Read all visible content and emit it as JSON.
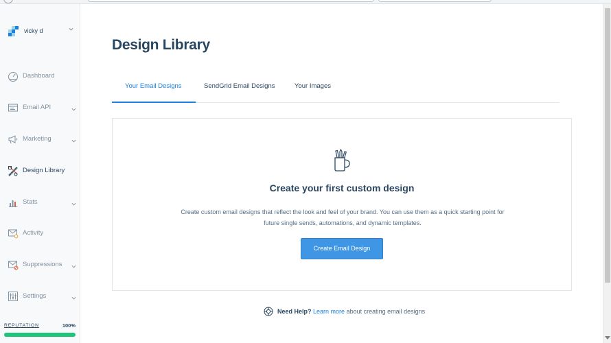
{
  "account": {
    "name": "vicky d"
  },
  "sidebar": {
    "items": [
      {
        "label": "Dashboard",
        "icon": "dashboard-gauge-icon",
        "has_caret": false
      },
      {
        "label": "Email API",
        "icon": "email-api-window-icon",
        "has_caret": true
      },
      {
        "label": "Marketing",
        "icon": "megaphone-icon",
        "has_caret": true
      },
      {
        "label": "Design Library",
        "icon": "design-tools-icon",
        "has_caret": false,
        "active": true
      },
      {
        "label": "Stats",
        "icon": "bar-chart-icon",
        "has_caret": true
      },
      {
        "label": "Activity",
        "icon": "activity-envelope-icon",
        "has_caret": false
      },
      {
        "label": "Suppressions",
        "icon": "suppression-envelope-icon",
        "has_caret": true
      },
      {
        "label": "Settings",
        "icon": "settings-sliders-icon",
        "has_caret": true
      }
    ]
  },
  "reputation": {
    "label": "REPUTATION",
    "value_text": "100%",
    "value": 1.0,
    "color": "#1ec47a"
  },
  "page": {
    "title": "Design Library"
  },
  "tabs": [
    {
      "label": "Your Email Designs",
      "active": true
    },
    {
      "label": "SendGrid Email Designs",
      "active": false
    },
    {
      "label": "Your Images",
      "active": false
    }
  ],
  "empty_state": {
    "icon": "pencil-cup-icon",
    "title": "Create your first custom design",
    "description_line1": "Create custom email designs that reflect the look and feel of your brand. You can use them as a quick starting point for",
    "description_line2": "future single sends, automations, and dynamic templates.",
    "button_label": "Create Email Design"
  },
  "help": {
    "icon": "lifebuoy-icon",
    "prefix": "Need Help?",
    "link_text": "Learn more",
    "suffix": "about creating email designs"
  },
  "colors": {
    "brand_text": "#294661",
    "link": "#1a82e2",
    "button": "#3f96e4",
    "reputation_bar": "#1ec47a"
  }
}
